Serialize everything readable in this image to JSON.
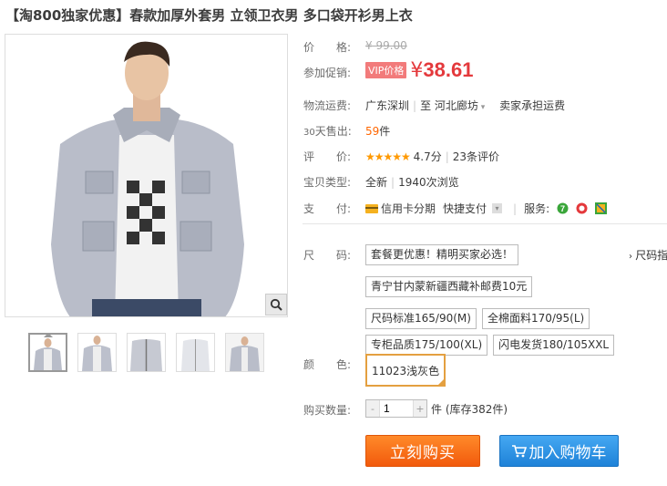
{
  "title": "【淘800独家优惠】春款加厚外套男 立领卫衣男 多口袋开衫男上衣",
  "price": {
    "label": "价　　格:",
    "value": "¥ 99.00"
  },
  "promo": {
    "label": "参加促销:",
    "badge": "VIP价格",
    "yen": "¥",
    "value": "38.61"
  },
  "shipping": {
    "label": "物流运费:",
    "from": "广东深圳",
    "to_word": "至",
    "to": "河北廊坊",
    "fee": "卖家承担运费"
  },
  "sales": {
    "label_prefix": "30",
    "label": "天售出:",
    "count": "59",
    "unit": "件"
  },
  "rating": {
    "label": "评　　价:",
    "stars": "★★★★★",
    "score": "4.7分",
    "reviews": "23条评价"
  },
  "type": {
    "label": "宝贝类型:",
    "condition": "全新",
    "views": "1940次浏览"
  },
  "payment": {
    "label": "支　　付:",
    "credit": "信用卡分期",
    "quick": "快捷支付",
    "service_label": "服务:"
  },
  "size": {
    "label": "尺　　码:",
    "chart_link": "尺码指",
    "options": [
      "套餐更优惠！精明买家必选！",
      "青宁甘内蒙新疆西藏补邮费10元",
      "尺码标准165/90(M)",
      "全棉面料170/95(L)",
      "专柜品质175/100(XL)",
      "闪电发货180/105XXL"
    ]
  },
  "color": {
    "label": "颜　　色:",
    "selected": "11023浅灰色"
  },
  "quantity": {
    "label": "购买数量:",
    "value": "1",
    "minus": "-",
    "plus": "+",
    "stock": "件 (库存382件)"
  },
  "buttons": {
    "buy": "立刻购买",
    "cart": "加入购物车"
  },
  "colors": {
    "promo_red": "#e4393c",
    "buy_orange": "#f25a0c",
    "cart_blue": "#1e82d8"
  }
}
